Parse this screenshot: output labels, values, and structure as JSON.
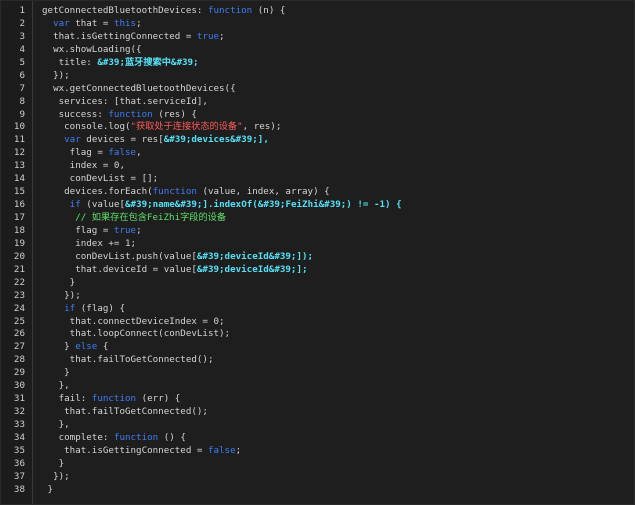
{
  "editor": {
    "lines": [
      [
        {
          "t": "getConnectedBluetoothDevices: "
        },
        {
          "t": "function",
          "c": "kw"
        },
        {
          "t": " (n) {"
        }
      ],
      [
        {
          "t": "  "
        },
        {
          "t": "var",
          "c": "kw"
        },
        {
          "t": " that = "
        },
        {
          "t": "this",
          "c": "kw"
        },
        {
          "t": ";"
        }
      ],
      [
        {
          "t": "  that.isGettingConnected = "
        },
        {
          "t": "true",
          "c": "kw"
        },
        {
          "t": ";"
        }
      ],
      [
        {
          "t": "  wx.showLoading({"
        }
      ],
      [
        {
          "t": "   title: "
        },
        {
          "t": "&#39;蓝牙搜索中&#39;",
          "c": "hl"
        }
      ],
      [
        {
          "t": "  });"
        }
      ],
      [
        {
          "t": "  wx.getConnectedBluetoothDevices({"
        }
      ],
      [
        {
          "t": "   services: [that.serviceId],"
        }
      ],
      [
        {
          "t": "   success: "
        },
        {
          "t": "function",
          "c": "kw"
        },
        {
          "t": " (res) {"
        }
      ],
      [
        {
          "t": "    console.log("
        },
        {
          "t": "\"获取处于连接状态的设备\"",
          "c": "str"
        },
        {
          "t": ", res);"
        }
      ],
      [
        {
          "t": "    "
        },
        {
          "t": "var",
          "c": "kw"
        },
        {
          "t": " devices = res["
        },
        {
          "t": "&#39;devices&#39;",
          "c": "hl"
        },
        {
          "t": "],",
          "c": "hl"
        }
      ],
      [
        {
          "t": "     flag = "
        },
        {
          "t": "false",
          "c": "kw"
        },
        {
          "t": ","
        }
      ],
      [
        {
          "t": "     index = 0,"
        }
      ],
      [
        {
          "t": "     conDevList = [];"
        }
      ],
      [
        {
          "t": "    devices.forEach("
        },
        {
          "t": "function",
          "c": "kw"
        },
        {
          "t": " (value, index, array) {"
        }
      ],
      [
        {
          "t": "     "
        },
        {
          "t": "if",
          "c": "kw"
        },
        {
          "t": " (value["
        },
        {
          "t": "&#39;name&#39;",
          "c": "hl"
        },
        {
          "t": "].indexOf(&#39;FeiZhi&#39;) != -1) {",
          "c": "hl"
        }
      ],
      [
        {
          "t": "      "
        },
        {
          "t": "// 如果存在包含FeiZhi字段的设备",
          "c": "cmt"
        }
      ],
      [
        {
          "t": "      flag = "
        },
        {
          "t": "true",
          "c": "kw"
        },
        {
          "t": ";"
        }
      ],
      [
        {
          "t": "      index += 1;"
        }
      ],
      [
        {
          "t": "      conDevList.push(value["
        },
        {
          "t": "&#39;deviceId&#39;",
          "c": "hl"
        },
        {
          "t": "]);",
          "c": "hl"
        }
      ],
      [
        {
          "t": "      that.deviceId = value["
        },
        {
          "t": "&#39;deviceId&#39;",
          "c": "hl"
        },
        {
          "t": "];",
          "c": "hl"
        }
      ],
      [
        {
          "t": "     }"
        }
      ],
      [
        {
          "t": "    });"
        }
      ],
      [
        {
          "t": "    "
        },
        {
          "t": "if",
          "c": "kw"
        },
        {
          "t": " (flag) {"
        }
      ],
      [
        {
          "t": "     that.connectDeviceIndex = 0;"
        }
      ],
      [
        {
          "t": "     that.loopConnect(conDevList);"
        }
      ],
      [
        {
          "t": "    } "
        },
        {
          "t": "else",
          "c": "kw"
        },
        {
          "t": " {"
        }
      ],
      [
        {
          "t": "     that.failToGetConnected();"
        }
      ],
      [
        {
          "t": "    }"
        }
      ],
      [
        {
          "t": "   },"
        }
      ],
      [
        {
          "t": "   fail: "
        },
        {
          "t": "function",
          "c": "kw"
        },
        {
          "t": " (err) {"
        }
      ],
      [
        {
          "t": "    that.failToGetConnected();"
        }
      ],
      [
        {
          "t": "   },"
        }
      ],
      [
        {
          "t": "   complete: "
        },
        {
          "t": "function",
          "c": "kw"
        },
        {
          "t": " () {"
        }
      ],
      [
        {
          "t": "    that.isGettingConnected = "
        },
        {
          "t": "false",
          "c": "kw"
        },
        {
          "t": ";"
        }
      ],
      [
        {
          "t": "   }"
        }
      ],
      [
        {
          "t": "  });"
        }
      ],
      [
        {
          "t": " }"
        }
      ]
    ]
  }
}
